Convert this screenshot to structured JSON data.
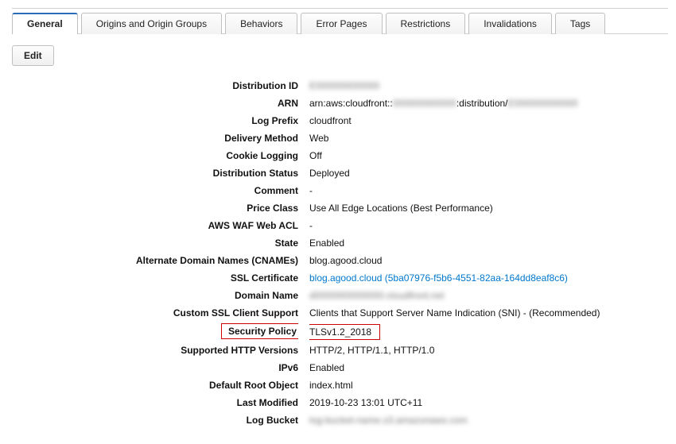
{
  "tabs": {
    "general": "General",
    "origins": "Origins and Origin Groups",
    "behaviors": "Behaviors",
    "errorPages": "Error Pages",
    "restrictions": "Restrictions",
    "invalidations": "Invalidations",
    "tags": "Tags"
  },
  "buttons": {
    "edit": "Edit"
  },
  "labels": {
    "distributionId": "Distribution ID",
    "arn": "ARN",
    "logPrefix": "Log Prefix",
    "deliveryMethod": "Delivery Method",
    "cookieLogging": "Cookie Logging",
    "distributionStatus": "Distribution Status",
    "comment": "Comment",
    "priceClass": "Price Class",
    "awsWafWebAcl": "AWS WAF Web ACL",
    "state": "State",
    "altDomainNames": "Alternate Domain Names (CNAMEs)",
    "sslCertificate": "SSL Certificate",
    "domainName": "Domain Name",
    "customSslClient": "Custom SSL Client Support",
    "securityPolicy": "Security Policy",
    "supportedHttp": "Supported HTTP Versions",
    "ipv6": "IPv6",
    "defaultRootObject": "Default Root Object",
    "lastModified": "Last Modified",
    "logBucket": "Log Bucket"
  },
  "values": {
    "distributionId": "E000000000000",
    "arnPrefix": "arn:aws:cloudfront::",
    "arnMid": "000000000000",
    "arnDist": ":distribution/",
    "arnSuffix": "E000000000000",
    "logPrefix": "cloudfront",
    "deliveryMethod": "Web",
    "cookieLogging": "Off",
    "distributionStatus": "Deployed",
    "comment": "-",
    "priceClass": "Use All Edge Locations (Best Performance)",
    "awsWafWebAcl": "-",
    "state": "Enabled",
    "altDomainNames": "blog.agood.cloud",
    "sslCertificate": "blog.agood.cloud (5ba07976-f5b6-4551-82aa-164dd8eaf8c6)",
    "domainName": "d0000000000000.cloudfront.net",
    "customSslClient": "Clients that Support Server Name Indication (SNI) - (Recommended)",
    "securityPolicy": "TLSv1.2_2018",
    "supportedHttp": "HTTP/2, HTTP/1.1, HTTP/1.0",
    "ipv6": "Enabled",
    "defaultRootObject": "index.html",
    "lastModified": "2019-10-23 13:01 UTC+11",
    "logBucket": "log-bucket-name.s3.amazonaws.com"
  }
}
